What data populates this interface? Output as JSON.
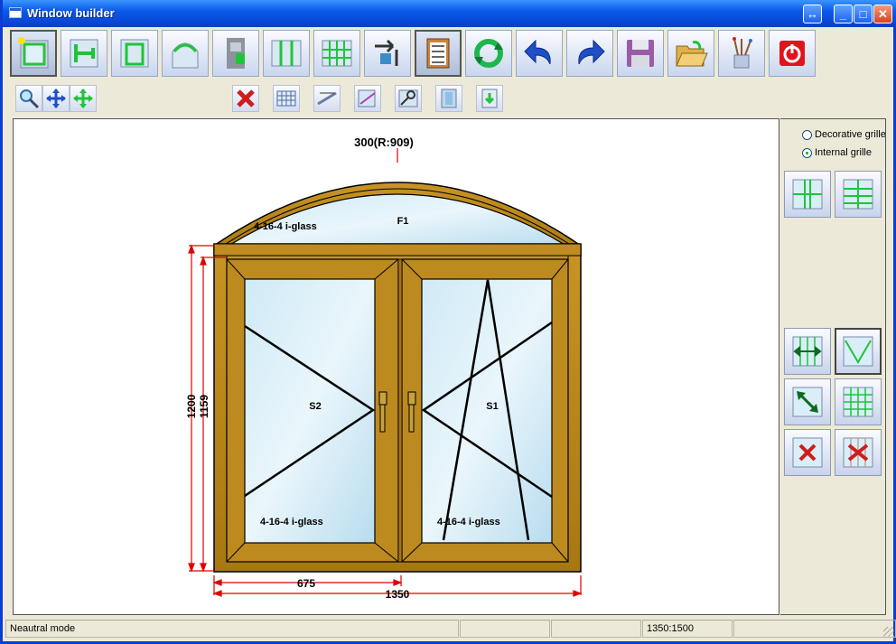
{
  "window": {
    "title": "Window builder"
  },
  "title_buttons": [
    {
      "icon": "restore-arrows-icon",
      "glyph": "↔"
    },
    {
      "icon": "minimize-icon",
      "glyph": "_"
    },
    {
      "icon": "maximize-icon",
      "glyph": "□"
    },
    {
      "icon": "close-icon",
      "glyph": "✕"
    }
  ],
  "toolbar_main": [
    {
      "name": "new-window-button",
      "icon": "new-window-icon"
    },
    {
      "name": "add-mullion-button",
      "icon": "mullion-icon"
    },
    {
      "name": "add-sash-button",
      "icon": "sash-icon"
    },
    {
      "name": "arch-button",
      "icon": "arch-icon"
    },
    {
      "name": "profile-button",
      "icon": "profile-icon"
    },
    {
      "name": "split-vertical-button",
      "icon": "split-vertical-icon"
    },
    {
      "name": "grid-button",
      "icon": "grid-icon"
    },
    {
      "name": "move-button",
      "icon": "move-icon"
    },
    {
      "name": "checklist-button",
      "icon": "checklist-icon"
    },
    {
      "name": "refresh-button",
      "icon": "refresh-icon"
    },
    {
      "name": "undo-button",
      "icon": "undo-icon"
    },
    {
      "name": "redo-button",
      "icon": "redo-icon"
    },
    {
      "name": "save-button",
      "icon": "floppy-disk-icon"
    },
    {
      "name": "open-button",
      "icon": "open-folder-icon"
    },
    {
      "name": "paint-button",
      "icon": "paint-brushes-icon"
    },
    {
      "name": "power-button",
      "icon": "power-icon"
    }
  ],
  "toolbar_secondary": [
    {
      "name": "zoom-button",
      "icon": "zoom-icon"
    },
    {
      "name": "move-all-button",
      "icon": "move-arrows-icon"
    },
    {
      "name": "fit-button",
      "icon": "fit-arrows-icon"
    },
    {
      "name": "delete-button",
      "icon": "delete-x-icon"
    },
    {
      "name": "grid-small-button",
      "icon": "grid-small-icon"
    },
    {
      "name": "dimension-button",
      "icon": "dimension-icon"
    },
    {
      "name": "glass-button",
      "icon": "glass-icon"
    },
    {
      "name": "tools-button",
      "icon": "tools-icon"
    },
    {
      "name": "frame-button",
      "icon": "frame-icon"
    },
    {
      "name": "export-button",
      "icon": "export-icon"
    }
  ],
  "grille_options": {
    "decorative": {
      "label": "Decorative grille",
      "selected": false
    },
    "internal": {
      "label": "Internal grille",
      "selected": true
    }
  },
  "drawing": {
    "arch_dimension": "300(R:909)",
    "fixed_label": "F1",
    "sash_left_label": "S2",
    "sash_right_label": "S1",
    "arch_glass": "4-16-4 i-glass",
    "left_glass": "4-16-4 i-glass",
    "right_glass": "4-16-4 i-glass",
    "height_outer": "1200",
    "height_inner": "1159",
    "width_half": "675",
    "width_total": "1350"
  },
  "colors": {
    "frame": "#b8860b",
    "glass": "#c6e6f4",
    "dimension": "#e00000"
  },
  "status": {
    "mode": "Neautral mode",
    "size": "1350:1500"
  }
}
